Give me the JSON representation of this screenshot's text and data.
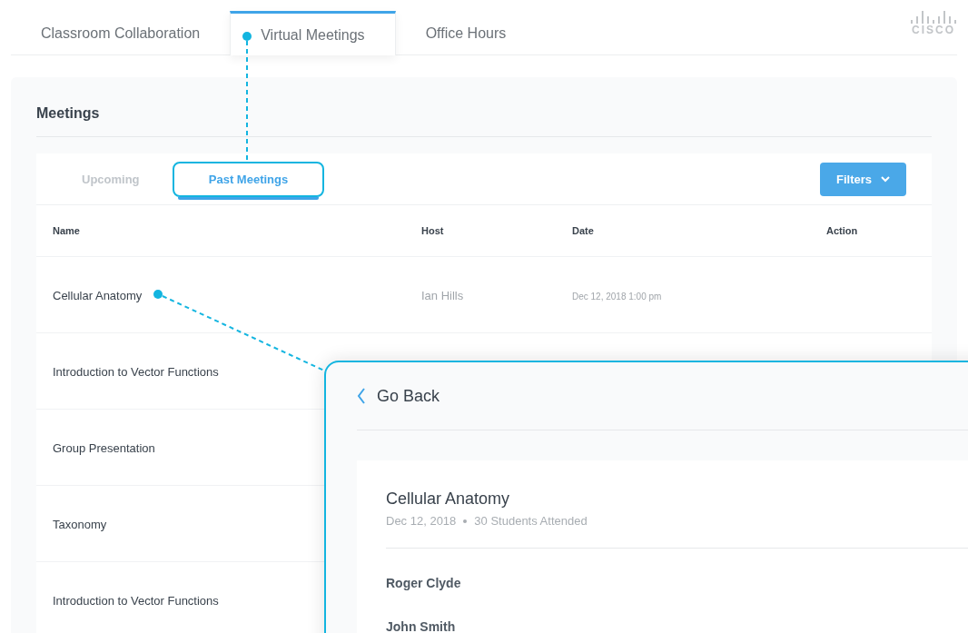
{
  "top_tabs": [
    {
      "label": "Classroom Collaboration",
      "selected": false
    },
    {
      "label": "Virtual Meetings",
      "selected": true
    },
    {
      "label": "Office Hours",
      "selected": false
    }
  ],
  "logo": {
    "text": "CISCO"
  },
  "meetings": {
    "title": "Meetings",
    "tabs": [
      {
        "label": "Upcoming",
        "selected": false
      },
      {
        "label": "Past Meetings",
        "selected": true
      }
    ],
    "filters_button": "Filters",
    "columns": [
      "Name",
      "Host",
      "Date",
      "Action"
    ],
    "rows": [
      {
        "name": "Cellular Anatomy",
        "host": "Ian Hills",
        "date": "Dec 12, 2018 1:00 pm"
      },
      {
        "name": "Introduction to Vector Functions"
      },
      {
        "name": "Group Presentation"
      },
      {
        "name": "Taxonomy"
      },
      {
        "name": "Introduction to Vector Functions"
      }
    ]
  },
  "detail": {
    "back": "Go Back",
    "title": "Cellular Anatomy",
    "date": "Dec 12, 2018",
    "attendance": "30 Students Attended",
    "attendees": [
      "Roger Clyde",
      "John Smith"
    ]
  }
}
